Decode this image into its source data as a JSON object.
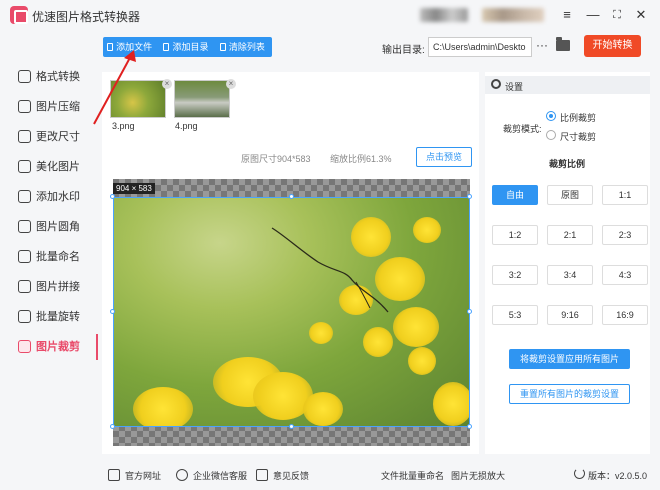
{
  "app": {
    "title": "优速图片格式转换器"
  },
  "window": {
    "minimize": "—",
    "maximize": "⛶",
    "close": "✕",
    "menu": "≡"
  },
  "toolbar": {
    "add_file": "添加文件",
    "add_folder": "添加目录",
    "clear_list": "清除列表",
    "output_label": "输出目录:",
    "output_path": "C:\\Users\\admin\\Deskto",
    "more": "···",
    "start": "开始转换"
  },
  "sidebar": {
    "items": [
      {
        "label": "格式转换",
        "icon": "format-convert-icon"
      },
      {
        "label": "图片压缩",
        "icon": "compress-icon"
      },
      {
        "label": "更改尺寸",
        "icon": "resize-icon"
      },
      {
        "label": "美化图片",
        "icon": "beautify-icon"
      },
      {
        "label": "添加水印",
        "icon": "watermark-icon"
      },
      {
        "label": "图片圆角",
        "icon": "round-corner-icon"
      },
      {
        "label": "批量命名",
        "icon": "rename-icon"
      },
      {
        "label": "图片拼接",
        "icon": "stitch-icon"
      },
      {
        "label": "批量旋转",
        "icon": "rotate-icon"
      },
      {
        "label": "图片裁剪",
        "icon": "crop-icon",
        "active": true
      }
    ]
  },
  "files": [
    {
      "name": "3.png"
    },
    {
      "name": "4.png"
    }
  ],
  "preview": {
    "original_size": "原图尺寸904*583",
    "scale": "缩放比例61.3%",
    "preview_button": "点击预览",
    "size_tag": "904 × 583"
  },
  "settings": {
    "title": "设置",
    "mode_label": "裁剪模式:",
    "mode_options": [
      "比例裁剪",
      "尺寸裁剪"
    ],
    "mode_selected": "比例裁剪",
    "ratio_heading": "裁剪比例",
    "ratios": [
      "自由",
      "原图",
      "1:1",
      "1:2",
      "2:1",
      "2:3",
      "3:2",
      "3:4",
      "4:3",
      "5:3",
      "9:16",
      "16:9"
    ],
    "ratio_selected": "自由",
    "apply_all": "将裁剪设置应用所有图片",
    "reset_all": "重置所有图片的裁剪设置"
  },
  "footer": {
    "website": "官方网址",
    "wechat": "企业微信客服",
    "feedback": "意见反馈",
    "batch_rename": "文件批量重命名",
    "upscale": "图片无损放大",
    "version": "版本：v2.0.5.0"
  },
  "colors": {
    "accent": "#2f95f2",
    "active": "#e94b6a",
    "start": "#f04a27"
  }
}
